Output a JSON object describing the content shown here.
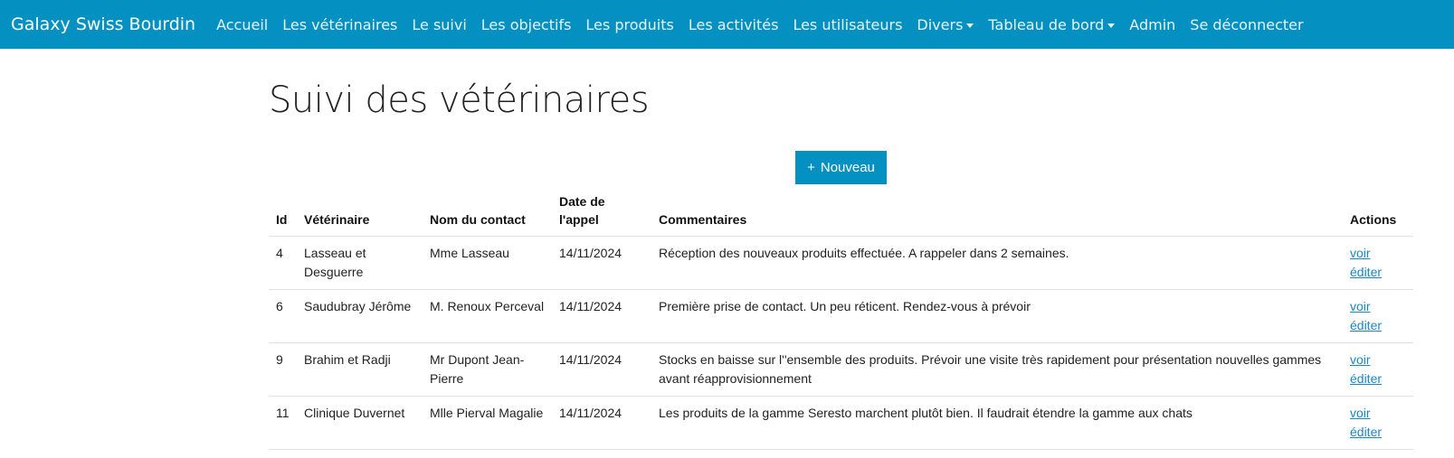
{
  "navbar": {
    "brand": "Galaxy Swiss Bourdin",
    "items": [
      {
        "label": "Accueil"
      },
      {
        "label": "Les vétérinaires"
      },
      {
        "label": "Le suivi"
      },
      {
        "label": "Les objectifs"
      },
      {
        "label": "Les produits"
      },
      {
        "label": "Les activités"
      },
      {
        "label": "Les utilisateurs"
      },
      {
        "label": "Divers"
      },
      {
        "label": "Tableau de bord"
      },
      {
        "label": "Admin"
      },
      {
        "label": "Se déconnecter"
      }
    ]
  },
  "page": {
    "title": "Suivi des vétérinaires",
    "new_button": "Nouveau",
    "new_button_icon": "+"
  },
  "table": {
    "headers": {
      "id": "Id",
      "vet": "Vétérinaire",
      "contact": "Nom du contact",
      "date": "Date de l'appel",
      "comment": "Commentaires",
      "actions": "Actions"
    },
    "rows": [
      {
        "id": "4",
        "vet": "Lasseau et Desguerre",
        "contact": "Mme Lasseau",
        "date": "14/11/2024",
        "comment": "Réception des nouveaux produits effectuée. A rappeler dans 2 semaines.",
        "view": "voir",
        "edit": "éditer"
      },
      {
        "id": "6",
        "vet": "Saudubray Jérôme",
        "contact": "M. Renoux Perceval",
        "date": "14/11/2024",
        "comment": "Première prise de contact. Un peu réticent. Rendez-vous à prévoir",
        "view": "voir",
        "edit": "éditer"
      },
      {
        "id": "9",
        "vet": "Brahim et Radji",
        "contact": "Mr Dupont Jean-Pierre",
        "date": "14/11/2024",
        "comment": "Stocks en baisse sur l''ensemble des produits. Prévoir une visite très rapidement pour présentation nouvelles gammes avant réapprovisionnement",
        "view": "voir",
        "edit": "éditer"
      },
      {
        "id": "11",
        "vet": "Clinique Duvernet",
        "contact": "Mlle Pierval Magalie",
        "date": "14/11/2024",
        "comment": "Les produits de la gamme Seresto marchent plutôt bien. Il faudrait étendre la gamme aux chats",
        "view": "voir",
        "edit": "éditer"
      }
    ]
  },
  "colors": {
    "primary": "#0590c2",
    "link": "#1a86c4"
  }
}
